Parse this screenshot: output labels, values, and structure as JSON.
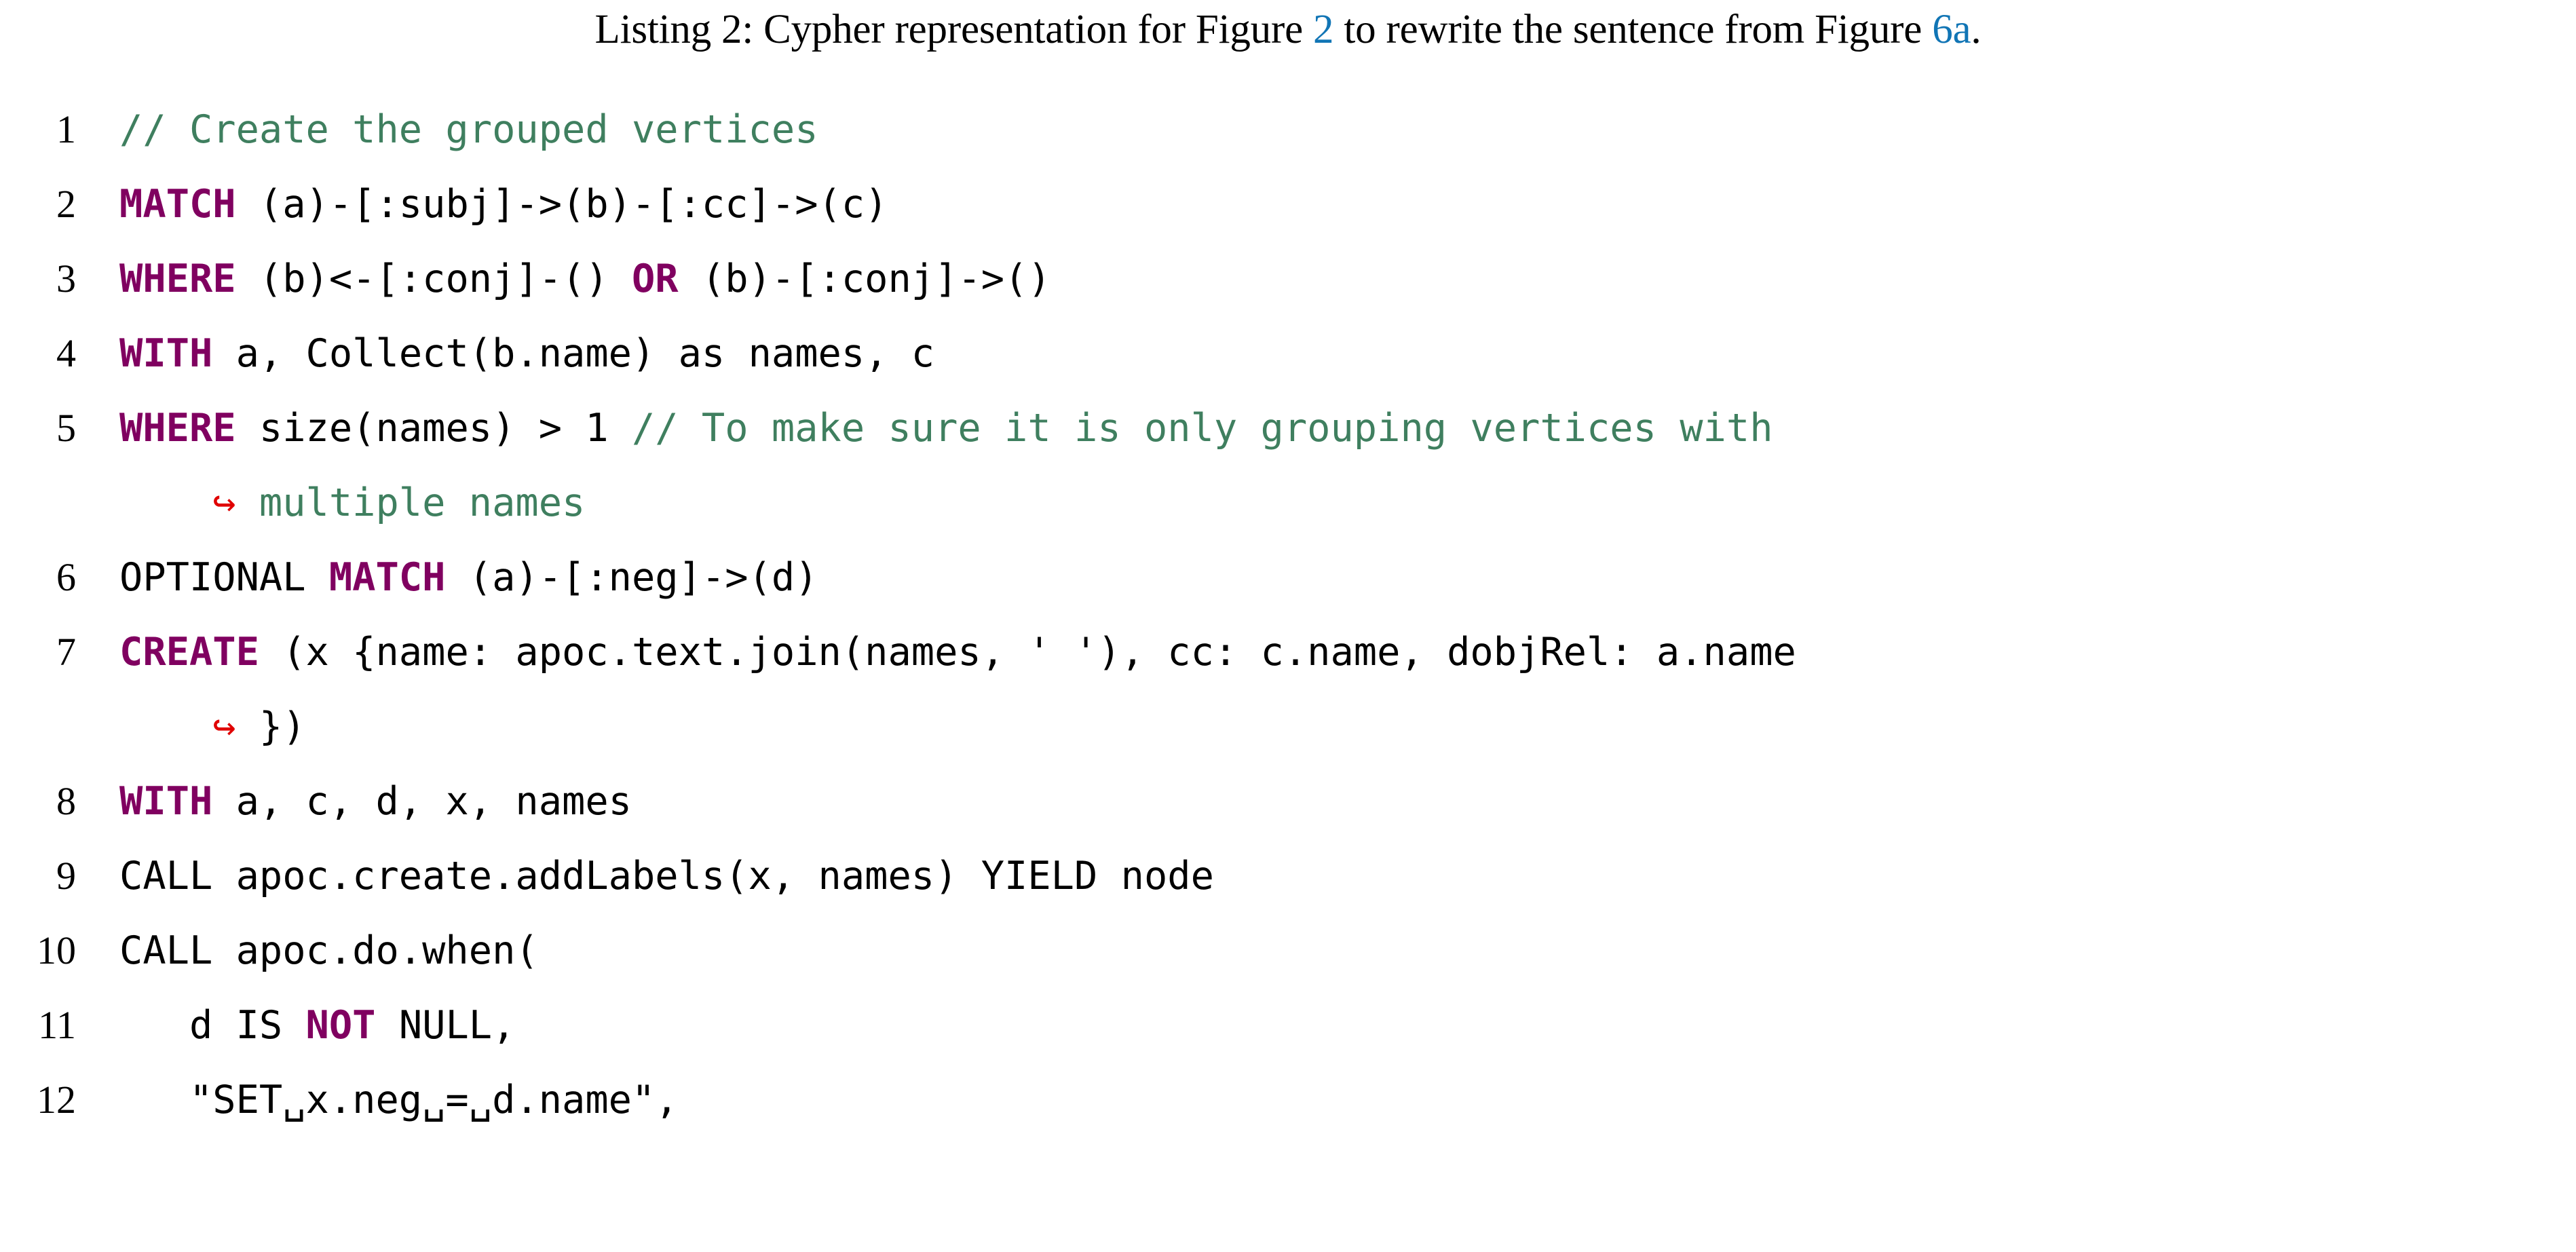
{
  "caption": {
    "prefix": "Listing 2: Cypher representation for Figure ",
    "link1": "2",
    "middle": " to rewrite the sentence from Figure ",
    "link2": "6a",
    "suffix": ".",
    "link_color": "#1175B5"
  },
  "colors": {
    "keyword": "#800060",
    "comment": "#3F7F5F",
    "plain": "#000000",
    "continuation_arrow": "#E00000",
    "background": "#FFFFFF",
    "link": "#1175B5"
  },
  "listing": {
    "language": "Cypher",
    "lines": [
      {
        "number": "1",
        "is_continuation": false,
        "tokens": [
          {
            "t": "// Create the grouped vertices",
            "c": "cmt"
          }
        ]
      },
      {
        "number": "2",
        "is_continuation": false,
        "tokens": [
          {
            "t": "MATCH",
            "c": "kw"
          },
          {
            "t": " (a)-[:subj]->(b)-[:cc]->(c)",
            "c": "plain"
          }
        ]
      },
      {
        "number": "3",
        "is_continuation": false,
        "tokens": [
          {
            "t": "WHERE",
            "c": "kw"
          },
          {
            "t": " (b)<-[:conj]-() ",
            "c": "plain"
          },
          {
            "t": "OR",
            "c": "kw"
          },
          {
            "t": " (b)-[:conj]->()",
            "c": "plain"
          }
        ]
      },
      {
        "number": "4",
        "is_continuation": false,
        "tokens": [
          {
            "t": "WITH",
            "c": "kw"
          },
          {
            "t": " a, Collect(b.name) as names, c",
            "c": "plain"
          }
        ]
      },
      {
        "number": "5",
        "is_continuation": false,
        "tokens": [
          {
            "t": "WHERE",
            "c": "kw"
          },
          {
            "t": " size(names) > 1 ",
            "c": "plain"
          },
          {
            "t": "// To make sure it is only grouping vertices with",
            "c": "cmt"
          }
        ]
      },
      {
        "number": "",
        "is_continuation": true,
        "tokens": [
          {
            "t": "    ↪ ",
            "c": "cont-arrow"
          },
          {
            "t": "multiple names",
            "c": "cmt"
          }
        ]
      },
      {
        "number": "6",
        "is_continuation": false,
        "tokens": [
          {
            "t": "OPTIONAL ",
            "c": "plain"
          },
          {
            "t": "MATCH",
            "c": "kw"
          },
          {
            "t": " (a)-[:neg]->(d)",
            "c": "plain"
          }
        ]
      },
      {
        "number": "7",
        "is_continuation": false,
        "tokens": [
          {
            "t": "CREATE",
            "c": "kw"
          },
          {
            "t": " (x {name: apoc.text.join(names, ' '), cc: c.name, dobjRel: a.name",
            "c": "plain"
          }
        ]
      },
      {
        "number": "",
        "is_continuation": true,
        "tokens": [
          {
            "t": "    ↪ ",
            "c": "cont-arrow"
          },
          {
            "t": "})",
            "c": "plain"
          }
        ]
      },
      {
        "number": "8",
        "is_continuation": false,
        "tokens": [
          {
            "t": "WITH",
            "c": "kw"
          },
          {
            "t": " a, c, d, x, names",
            "c": "plain"
          }
        ]
      },
      {
        "number": "9",
        "is_continuation": false,
        "tokens": [
          {
            "t": "CALL apoc.create.addLabels(x, names) YIELD node",
            "c": "plain"
          }
        ]
      },
      {
        "number": "10",
        "is_continuation": false,
        "tokens": [
          {
            "t": "CALL apoc.do.when(",
            "c": "plain"
          }
        ]
      },
      {
        "number": "11",
        "is_continuation": false,
        "tokens": [
          {
            "t": "   d IS ",
            "c": "plain"
          },
          {
            "t": "NOT",
            "c": "kw"
          },
          {
            "t": " NULL,",
            "c": "plain"
          }
        ]
      },
      {
        "number": "12",
        "is_continuation": false,
        "tokens": [
          {
            "t": "   \"SET␣x.neg␣=␣d.name\",",
            "c": "plain"
          }
        ]
      }
    ]
  }
}
